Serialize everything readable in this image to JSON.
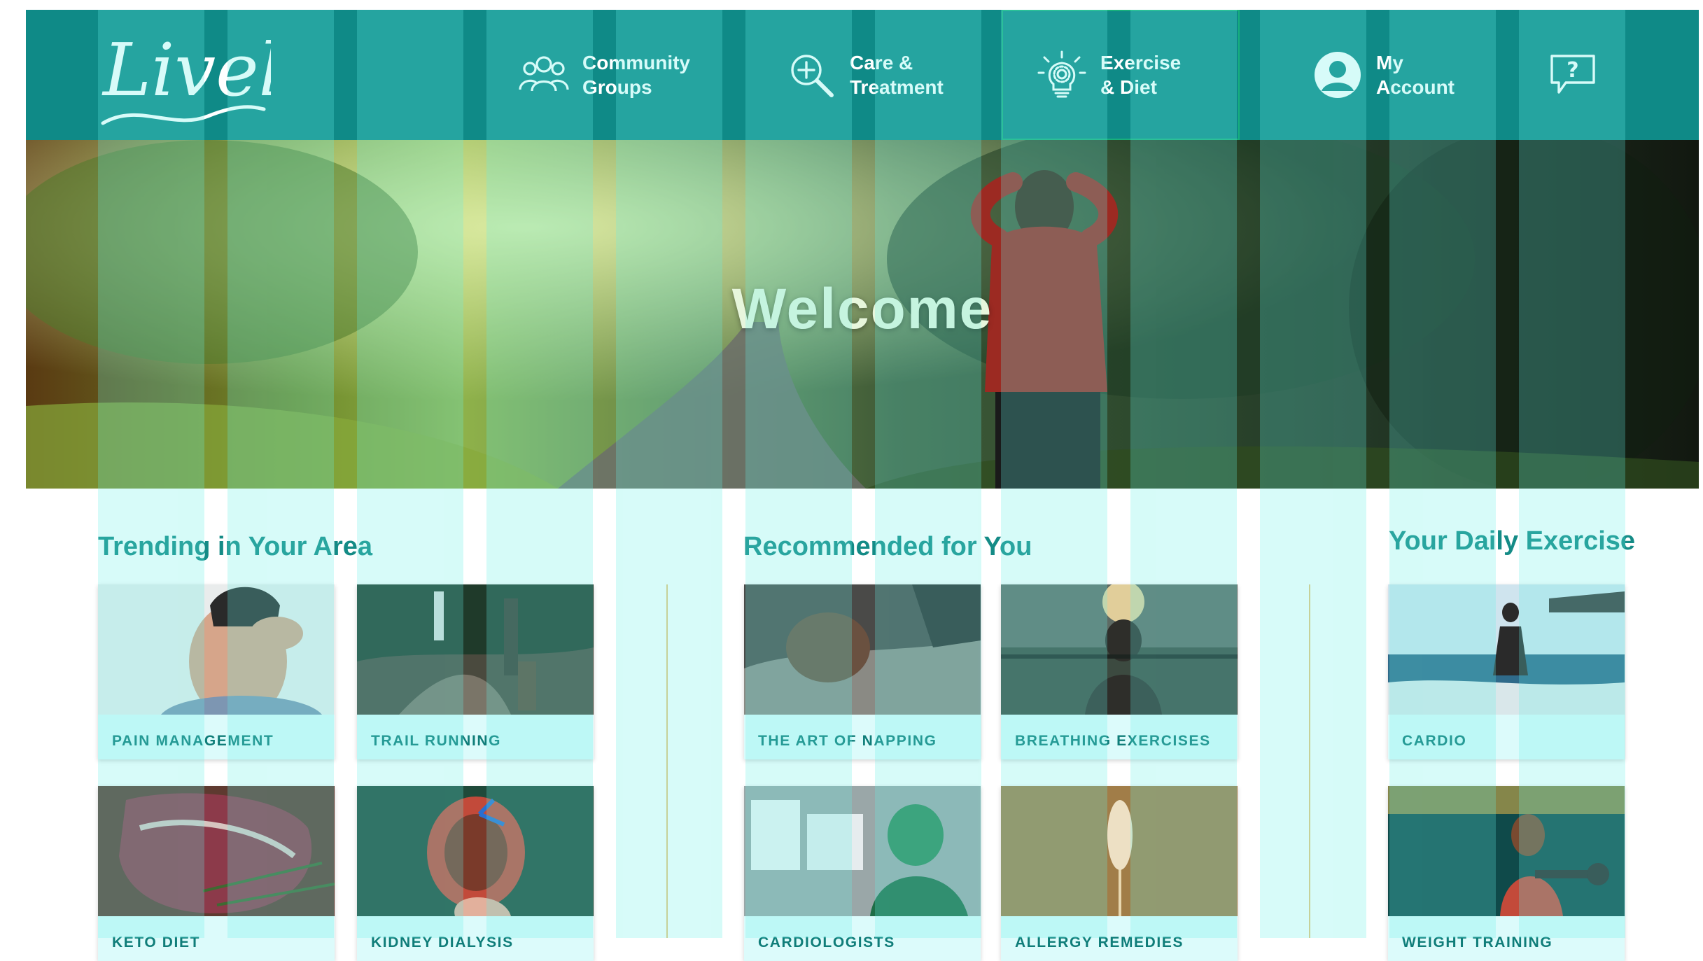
{
  "brand": {
    "logo_text": "Lively"
  },
  "nav": {
    "community": {
      "line1": "Community",
      "line2": "Groups",
      "icon": "people-group-icon"
    },
    "care": {
      "line1": "Care &",
      "line2": "Treatment",
      "icon": "magnifier-plus-icon"
    },
    "exercise": {
      "line1": "Exercise",
      "line2": "& Diet",
      "icon": "lightbulb-gear-icon",
      "active": true
    },
    "account": {
      "line1": "My",
      "line2": "Account",
      "icon": "user-avatar-icon"
    },
    "help": {
      "icon": "help-question-bubble-icon"
    }
  },
  "hero": {
    "title": "Welcome"
  },
  "trending": {
    "heading": "Trending in Your Area",
    "cards": [
      "PAIN MANAGEMENT",
      "TRAIL RUNNING",
      "KETO DIET",
      "KIDNEY DIALYSIS"
    ]
  },
  "recommended": {
    "heading": "Recommended for You",
    "cards": [
      "THE ART OF NAPPING",
      "BREATHING EXERCISES",
      "CARDIOLOGISTS",
      "ALLERGY REMEDIES"
    ]
  },
  "daily": {
    "heading": "Your Daily Exercise",
    "cards": [
      "CARDIO",
      "WEIGHT TRAINING"
    ]
  },
  "colors": {
    "header_teal": "#0f8a87",
    "heading_teal": "#148b86",
    "card_bg": "#dcfbfb",
    "divider_gold": "#e8c77e",
    "active_outline": "#17b07c"
  }
}
